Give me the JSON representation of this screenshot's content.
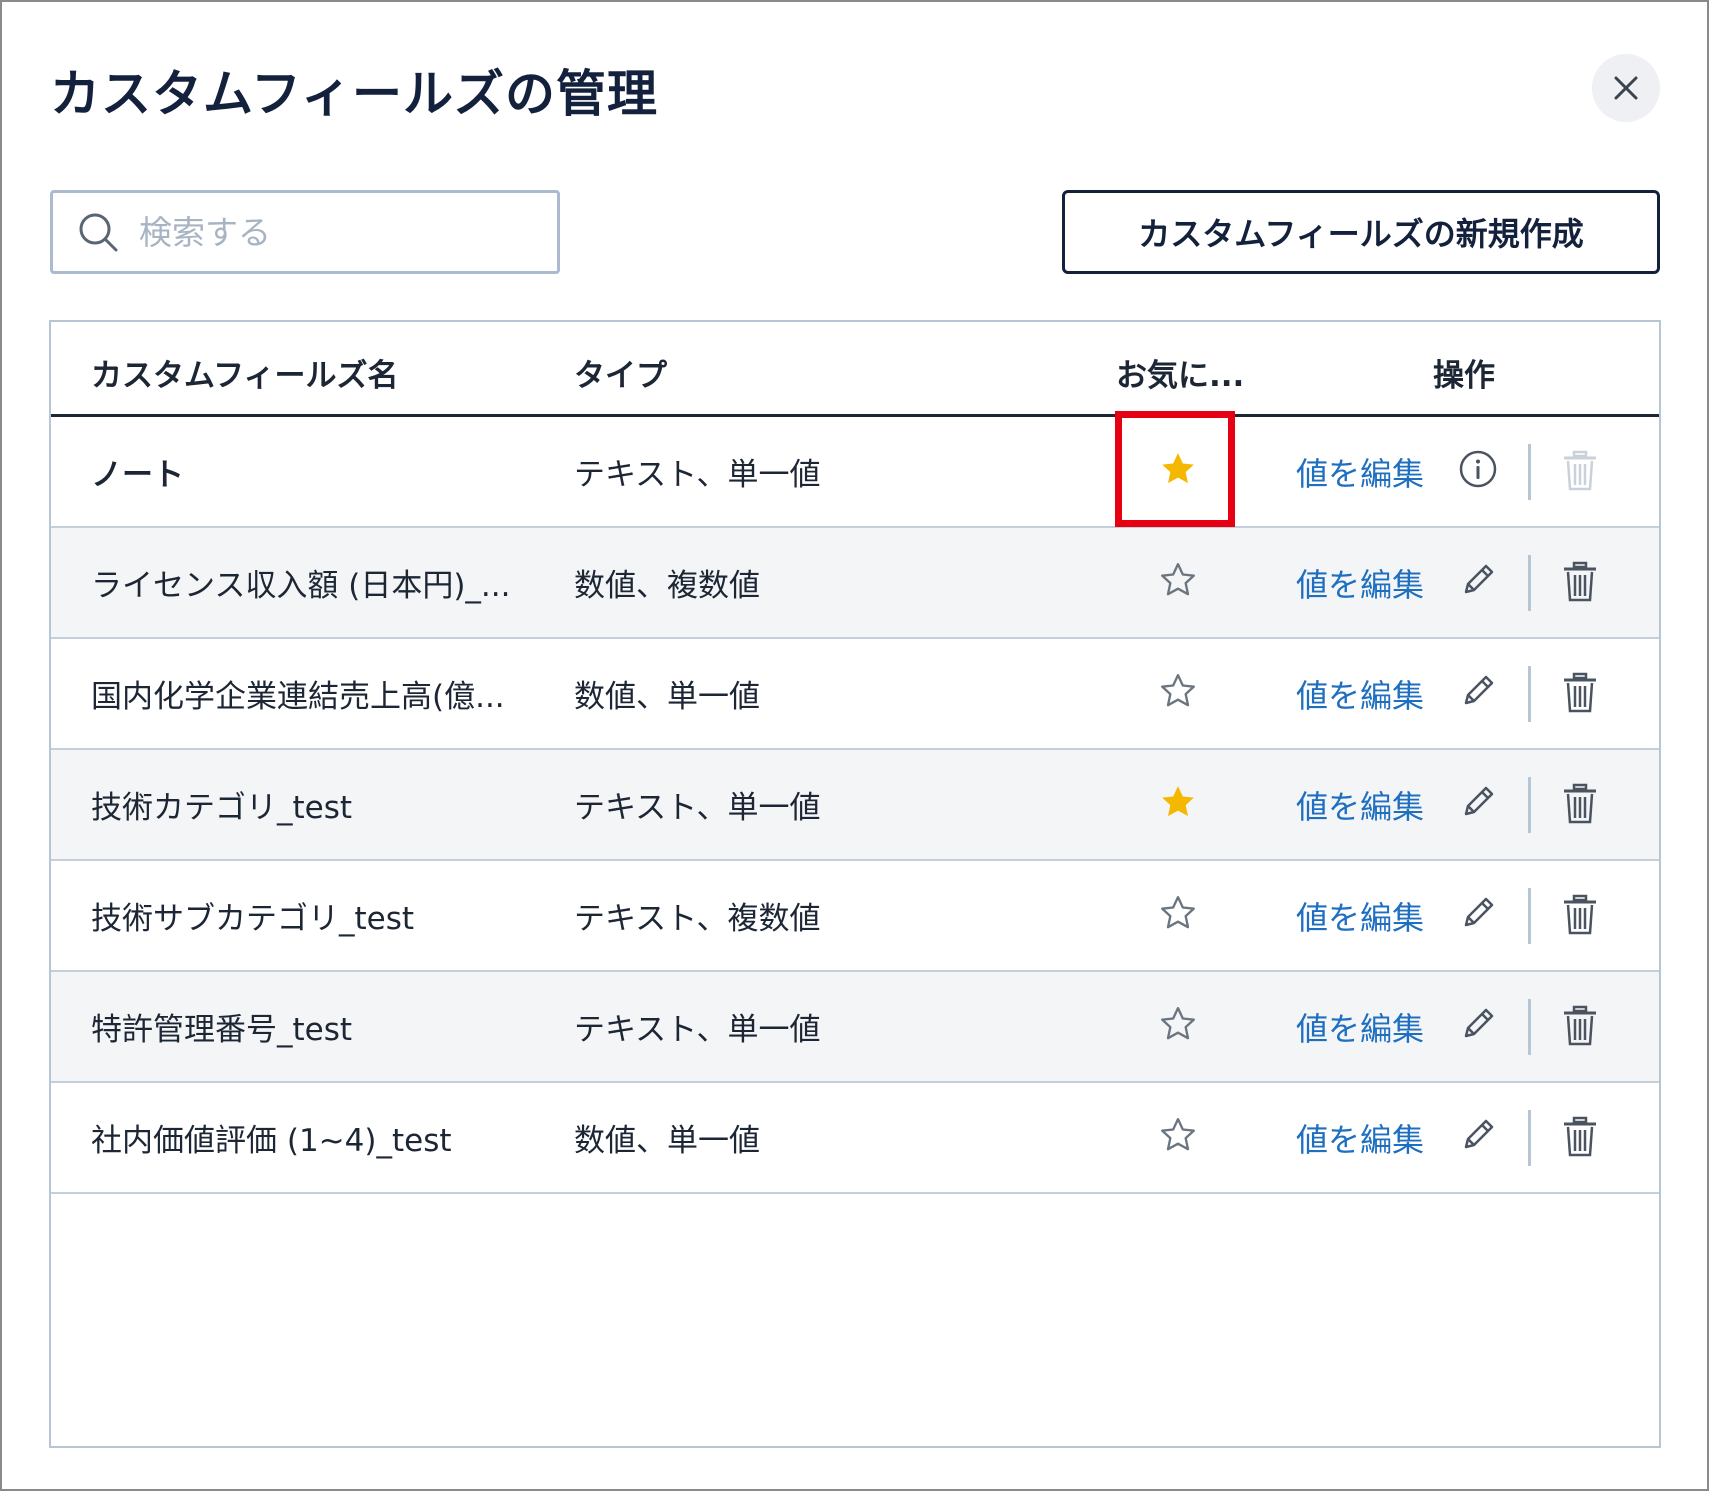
{
  "dialog": {
    "title": "カスタムフィールズの管理",
    "close_icon": "close-icon"
  },
  "search": {
    "placeholder": "検索する",
    "value": "",
    "icon": "search-icon"
  },
  "create_button": {
    "label": "カスタムフィールズの新規作成"
  },
  "table": {
    "headers": {
      "name": "カスタムフィールズ名",
      "type": "タイプ",
      "favorite": "お気に...",
      "actions": "操作"
    },
    "edit_label": "値を編集",
    "rows": [
      {
        "name": "ノート",
        "type": "テキスト、単一値",
        "favorite": true,
        "action_icon": "info-icon",
        "delete_enabled": false
      },
      {
        "name": "ライセンス収入額 (日本円)_...",
        "type": "数値、複数値",
        "favorite": false,
        "action_icon": "pencil-icon",
        "delete_enabled": true
      },
      {
        "name": "国内化学企業連結売上高(億...",
        "type": "数値、単一値",
        "favorite": false,
        "action_icon": "pencil-icon",
        "delete_enabled": true
      },
      {
        "name": "技術カテゴリ_test",
        "type": "テキスト、単一値",
        "favorite": true,
        "action_icon": "pencil-icon",
        "delete_enabled": true
      },
      {
        "name": "技術サブカテゴリ_test",
        "type": "テキスト、複数値",
        "favorite": false,
        "action_icon": "pencil-icon",
        "delete_enabled": true
      },
      {
        "name": "特許管理番号_test",
        "type": "テキスト、単一値",
        "favorite": false,
        "action_icon": "pencil-icon",
        "delete_enabled": true
      },
      {
        "name": "社内価値評価 (1~4)_test",
        "type": "数値、単一値",
        "favorite": false,
        "action_icon": "pencil-icon",
        "delete_enabled": true
      }
    ]
  },
  "colors": {
    "star_filled": "#f5b800",
    "star_empty": "#6b7580",
    "link": "#1f6fc1",
    "highlight": "#e60012",
    "trash_disabled": "#c9d2db",
    "trash_enabled": "#4a5460"
  }
}
